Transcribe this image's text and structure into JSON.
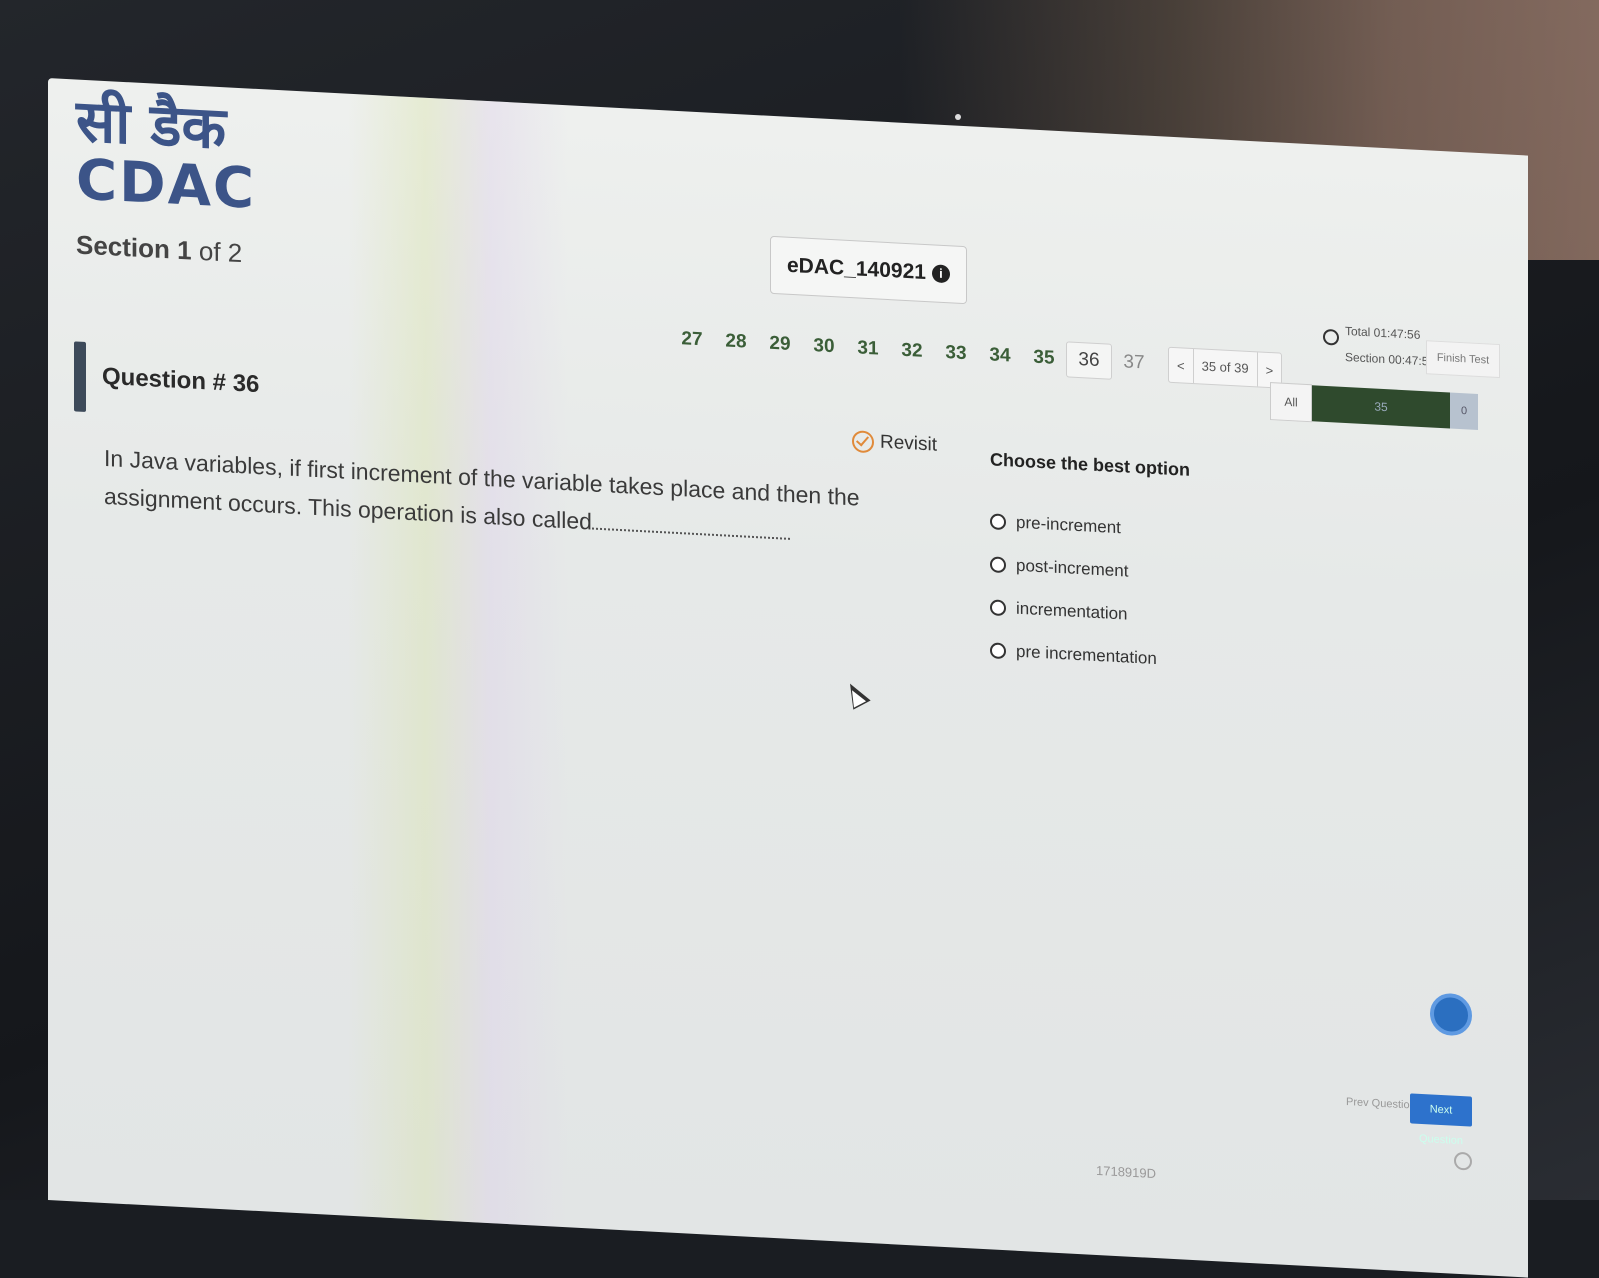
{
  "brand": {
    "logo_hindi": "सी डैक",
    "logo_english": "CDAC",
    "primary_color": "#3c5488"
  },
  "section": {
    "prefix": "Section",
    "current": "1",
    "suffix": "of 2"
  },
  "exam": {
    "id_label": "eDAC_140921",
    "info_icon": "i"
  },
  "timer": {
    "total_label": "Total 01:47:56",
    "section_label": "Section 00:47:56",
    "finish_label": "Finish Test"
  },
  "navigation": {
    "question_numbers": [
      "27",
      "28",
      "29",
      "30",
      "31",
      "32",
      "33",
      "34",
      "35",
      "36",
      "37"
    ],
    "current_question": "36",
    "pager_prev": "<",
    "pager_status": "35 of 39",
    "pager_next": ">",
    "filter_all": "All",
    "filter_count": "35",
    "filter_end": "0"
  },
  "question": {
    "title": "Question # 36",
    "revisit_label": "Revisit",
    "text": "In Java variables, if first increment of the variable takes place and then the assignment occurs. This operation is also called",
    "options_heading": "Choose the best option",
    "options": [
      {
        "label": "pre-increment",
        "selected": false
      },
      {
        "label": "post-increment",
        "selected": false
      },
      {
        "label": "incrementation",
        "selected": false
      },
      {
        "label": "pre incrementation",
        "selected": false
      }
    ]
  },
  "footer": {
    "prev_label": "Prev Question",
    "next_label": "Next Question",
    "code": "1718919D"
  },
  "icons": {
    "clock": "clock-icon",
    "revisit": "revisit-icon",
    "chat": "chat-icon",
    "power": "power-icon"
  }
}
